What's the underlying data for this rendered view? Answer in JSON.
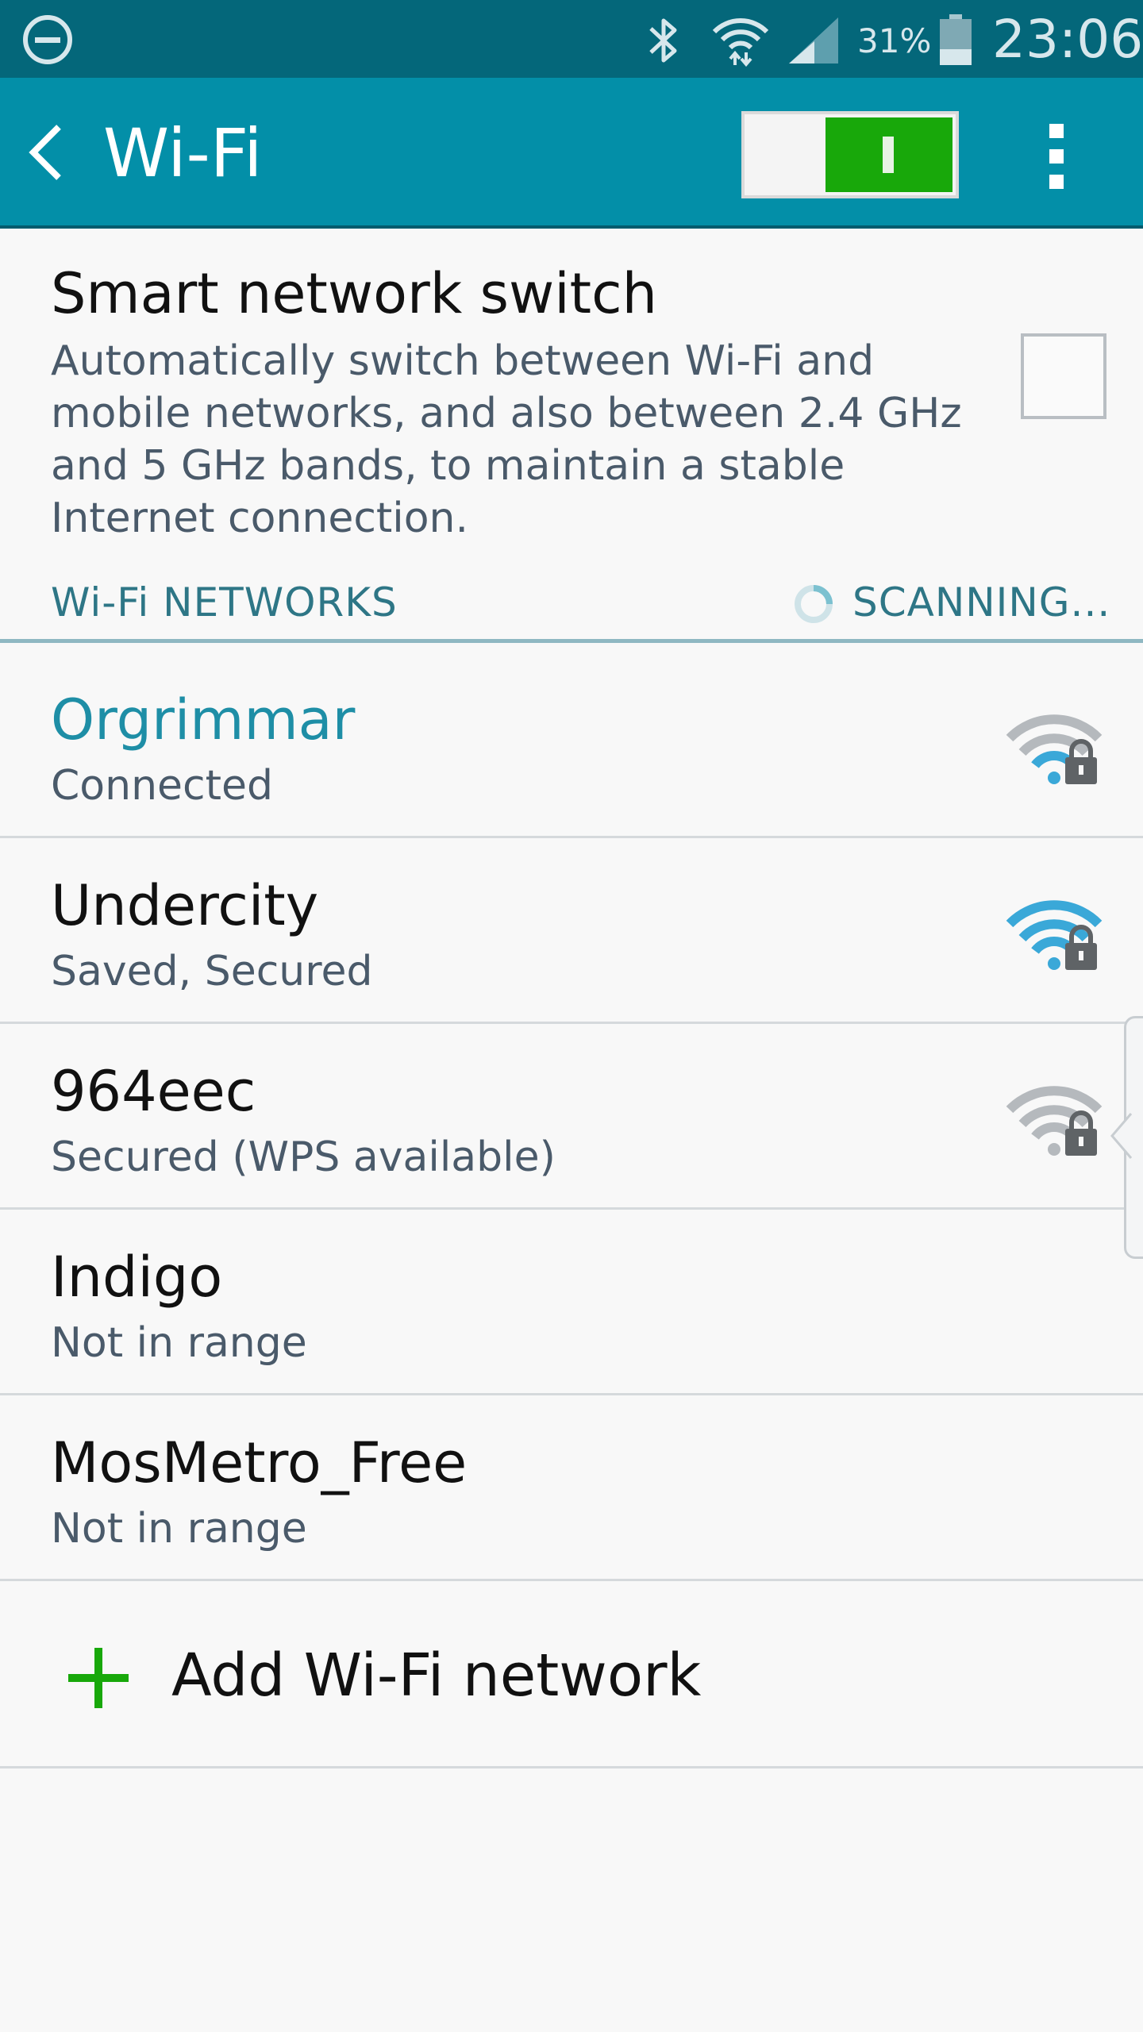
{
  "status_bar": {
    "battery_percent": "31%",
    "time": "23:06",
    "icons": [
      "do-not-disturb-icon",
      "bluetooth-icon",
      "wifi-icon",
      "cell-signal-icon",
      "battery-icon"
    ]
  },
  "action_bar": {
    "title": "Wi-Fi",
    "wifi_toggle_on": true,
    "colors": {
      "bar": "#038fa8",
      "status": "#04677a",
      "toggle_on": "#18a80a"
    }
  },
  "smart_switch": {
    "title": "Smart network switch",
    "description": "Automatically switch between Wi-Fi and mobile networks, and also between 2.4 GHz and 5 GHz bands, to maintain a stable Internet connection.",
    "checked": false
  },
  "networks_section": {
    "label": "Wi-Fi NETWORKS",
    "scan_status": "SCANNING..."
  },
  "networks": [
    {
      "name": "Orgrimmar",
      "status": "Connected",
      "connected": true,
      "signal_bars": 1,
      "secured": true
    },
    {
      "name": "Undercity",
      "status": "Saved, Secured",
      "connected": false,
      "signal_bars": 4,
      "secured": true
    },
    {
      "name": "964eec",
      "status": "Secured (WPS available)",
      "connected": false,
      "signal_bars": 0,
      "secured": true
    },
    {
      "name": "Indigo",
      "status": "Not in range",
      "connected": false
    },
    {
      "name": "MosMetro_Free",
      "status": "Not in range",
      "connected": false
    }
  ],
  "add_network": {
    "label": "Add Wi-Fi network"
  }
}
